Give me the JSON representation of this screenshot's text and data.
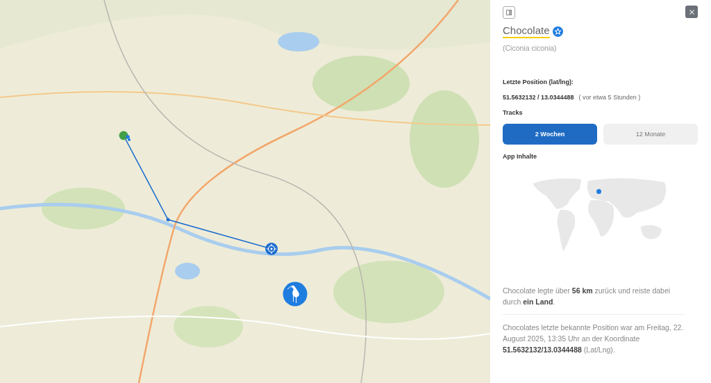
{
  "panel": {
    "title": "Chocolate",
    "species": "(Ciconia ciconia)",
    "position_label": "Letzte Position (lat/lng):",
    "position": "51.5632132 / 13.0344488",
    "age": "( vor etwa 5 Stunden )",
    "tracks_label": "Tracks",
    "tracks": [
      {
        "label": "2 Wochen",
        "selected": true
      },
      {
        "label": "12 Monate",
        "selected": false
      }
    ],
    "app_label": "App Inhalte",
    "summary": "Chocolate legte über **56 km** zurück und reiste dabei durch **ein Land**.",
    "last_seen": "Chocolates letzte bekannte Position war am Freitag, 22. August 2025, 13:35 Uhr an der Koordinate **51.5632132/13.0344488** (Lat/Lng)."
  }
}
